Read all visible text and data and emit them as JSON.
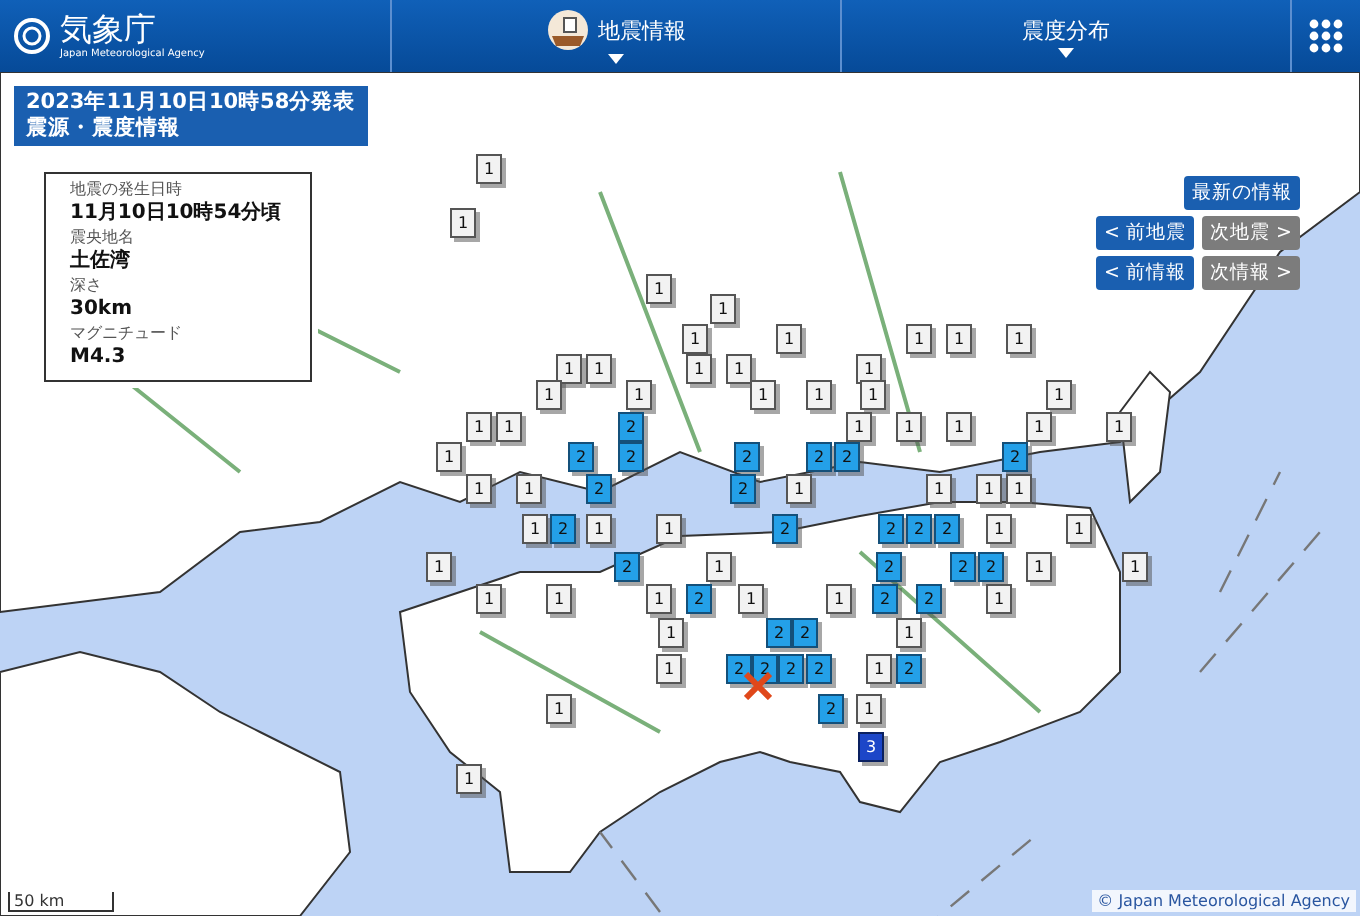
{
  "header": {
    "logo": {
      "name": "気象庁",
      "subtitle": "Japan Meteorological Agency"
    },
    "nav": [
      {
        "label": "地震情報",
        "has_icon": true
      },
      {
        "label": "震度分布",
        "has_icon": false
      }
    ]
  },
  "title": {
    "lines": [
      "2023年11月10日10時58分発表",
      "震源・震度情報"
    ]
  },
  "info": [
    {
      "label": "地震の発生日時",
      "value": "11月10日10時54分頃"
    },
    {
      "label": "震央地名",
      "value": "土佐湾"
    },
    {
      "label": "深さ",
      "value": "30km"
    },
    {
      "label": "マグニチュード",
      "value": "M4.3"
    }
  ],
  "buttons": [
    {
      "label": "最新の情報",
      "disabled": false
    },
    {
      "label": "< 前地震",
      "disabled": false
    },
    {
      "label": "次地震 >",
      "disabled": true
    },
    {
      "label": "< 前情報",
      "disabled": false
    },
    {
      "label": "次情報 >",
      "disabled": true
    }
  ],
  "markers": [
    {
      "label": "1",
      "kind": "i1"
    },
    {
      "label": "1",
      "kind": "i1"
    },
    {
      "label": "1",
      "kind": "i1"
    },
    {
      "label": "1",
      "kind": "i1"
    },
    {
      "label": "1",
      "kind": "i1"
    },
    {
      "label": "1",
      "kind": "i1"
    },
    {
      "label": "1",
      "kind": "i1"
    },
    {
      "label": "1",
      "kind": "i1"
    },
    {
      "label": "1",
      "kind": "i1"
    },
    {
      "label": "1",
      "kind": "i1"
    },
    {
      "label": "1",
      "kind": "i1"
    },
    {
      "label": "1",
      "kind": "i1"
    },
    {
      "label": "1",
      "kind": "i1"
    },
    {
      "label": "1",
      "kind": "i1"
    },
    {
      "label": "1",
      "kind": "i1"
    },
    {
      "label": "1",
      "kind": "i1"
    },
    {
      "label": "1",
      "kind": "i1"
    },
    {
      "label": "1",
      "kind": "i1"
    },
    {
      "label": "1",
      "kind": "i1"
    },
    {
      "label": "1",
      "kind": "i1"
    },
    {
      "label": "1",
      "kind": "i1"
    },
    {
      "label": "1",
      "kind": "i1"
    },
    {
      "label": "2",
      "kind": "i2"
    },
    {
      "label": "1",
      "kind": "i1"
    },
    {
      "label": "1",
      "kind": "i1"
    },
    {
      "label": "1",
      "kind": "i1"
    },
    {
      "label": "1",
      "kind": "i1"
    },
    {
      "label": "1",
      "kind": "i1"
    },
    {
      "label": "1",
      "kind": "i1"
    },
    {
      "label": "2",
      "kind": "i2"
    },
    {
      "label": "2",
      "kind": "i2"
    },
    {
      "label": "2",
      "kind": "i2"
    },
    {
      "label": "2",
      "kind": "i2"
    },
    {
      "label": "2",
      "kind": "i2"
    },
    {
      "label": "2",
      "kind": "i2"
    },
    {
      "label": "1",
      "kind": "i1"
    },
    {
      "label": "1",
      "kind": "i1"
    },
    {
      "label": "2",
      "kind": "i2"
    },
    {
      "label": "2",
      "kind": "i2"
    },
    {
      "label": "1",
      "kind": "i1"
    },
    {
      "label": "1",
      "kind": "i1"
    },
    {
      "label": "1",
      "kind": "i1"
    },
    {
      "label": "1",
      "kind": "i1"
    },
    {
      "label": "1",
      "kind": "i1"
    },
    {
      "label": "2",
      "kind": "i2"
    },
    {
      "label": "1",
      "kind": "i1"
    },
    {
      "label": "1",
      "kind": "i1"
    },
    {
      "label": "2",
      "kind": "i2"
    },
    {
      "label": "2",
      "kind": "i2"
    },
    {
      "label": "2",
      "kind": "i2"
    },
    {
      "label": "2",
      "kind": "i2"
    },
    {
      "label": "1",
      "kind": "i1"
    },
    {
      "label": "1",
      "kind": "i1"
    },
    {
      "label": "1",
      "kind": "i1"
    },
    {
      "label": "2",
      "kind": "i2"
    },
    {
      "label": "1",
      "kind": "i1"
    },
    {
      "label": "2",
      "kind": "i2"
    },
    {
      "label": "2",
      "kind": "i2"
    },
    {
      "label": "2",
      "kind": "i2"
    },
    {
      "label": "1",
      "kind": "i1"
    },
    {
      "label": "1",
      "kind": "i1"
    },
    {
      "label": "1",
      "kind": "i1"
    },
    {
      "label": "1",
      "kind": "i1"
    },
    {
      "label": "1",
      "kind": "i1"
    },
    {
      "label": "2",
      "kind": "i2"
    },
    {
      "label": "1",
      "kind": "i1"
    },
    {
      "label": "1",
      "kind": "i1"
    },
    {
      "label": "2",
      "kind": "i2"
    },
    {
      "label": "2",
      "kind": "i2"
    },
    {
      "label": "1",
      "kind": "i1"
    },
    {
      "label": "1",
      "kind": "i1"
    },
    {
      "label": "2",
      "kind": "i2"
    },
    {
      "label": "2",
      "kind": "i2"
    },
    {
      "label": "1",
      "kind": "i1"
    },
    {
      "label": "1",
      "kind": "i1"
    },
    {
      "label": "2",
      "kind": "i2"
    },
    {
      "label": "2",
      "kind": "i2"
    },
    {
      "label": "2",
      "kind": "i2"
    },
    {
      "label": "2",
      "kind": "i2"
    },
    {
      "label": "1",
      "kind": "i1"
    },
    {
      "label": "2",
      "kind": "i2"
    },
    {
      "label": "1",
      "kind": "i1"
    },
    {
      "label": "2",
      "kind": "i2"
    },
    {
      "label": "1",
      "kind": "i1"
    },
    {
      "label": "3",
      "kind": "i3"
    },
    {
      "label": "1",
      "kind": "i1"
    }
  ],
  "scale": "50 km",
  "copyright": "© Japan Meteorological Agency"
}
